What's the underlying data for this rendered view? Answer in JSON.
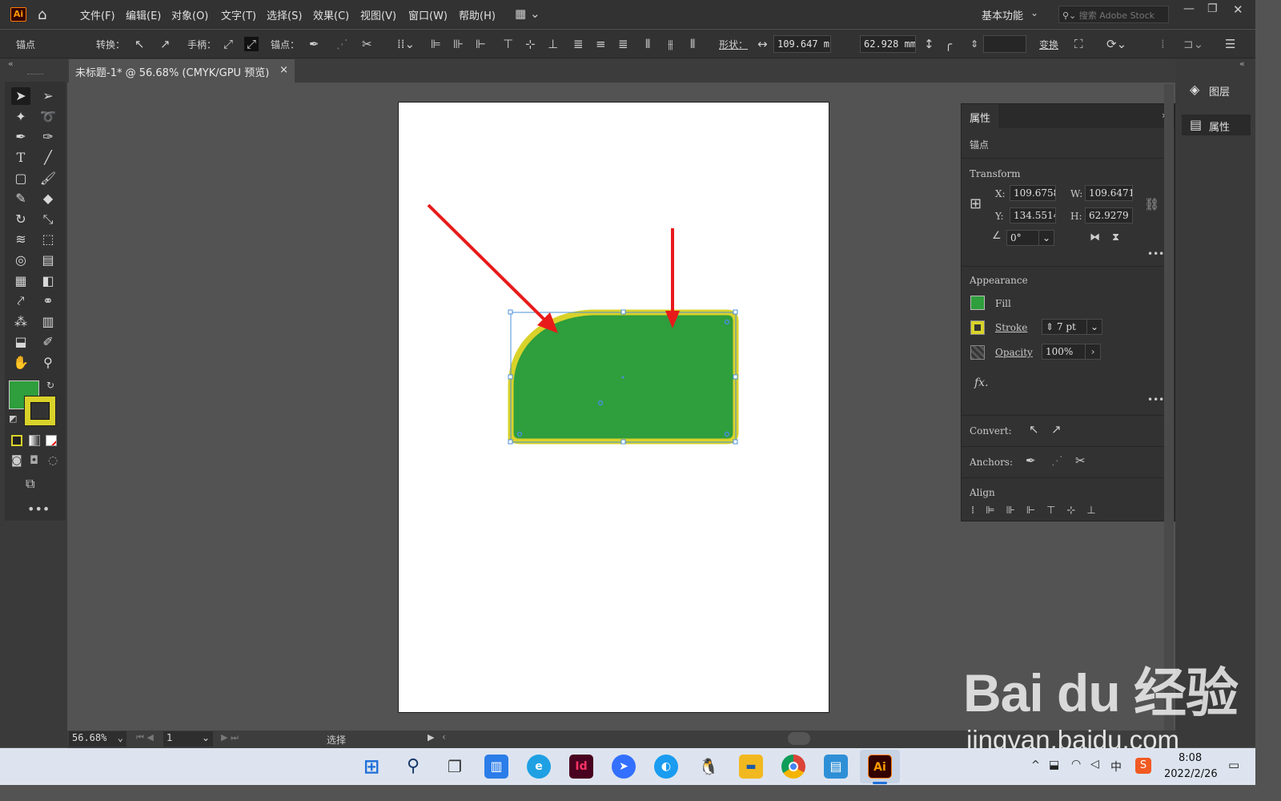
{
  "menubar": {
    "items": [
      "文件(F)",
      "编辑(E)",
      "对象(O)",
      "文字(T)",
      "选择(S)",
      "效果(C)",
      "视图(V)",
      "窗口(W)",
      "帮助(H)"
    ],
    "workspace": "基本功能",
    "search_placeholder": "搜索 Adobe Stock"
  },
  "control": {
    "label": "锚点",
    "convert": "转换：",
    "handles": "手柄：",
    "anchors": "锚点：",
    "shape": "形状：",
    "width_value": "109.647 m",
    "height_value": "62.928 mm",
    "transform_label": "变换"
  },
  "document": {
    "tab_title": "未标题-1* @ 56.68% (CMYK/GPU 预览)",
    "close": "×"
  },
  "panel": {
    "tab": "属性",
    "context": "锚点",
    "transform_title": "Transform",
    "x_label": "X:",
    "x_value": "109.6758",
    "y_label": "Y:",
    "y_value": "134.5514",
    "w_label": "W:",
    "w_value": "109.6471",
    "h_label": "H:",
    "h_value": "62.9279",
    "angle_value": "0°",
    "appearance_title": "Appearance",
    "fill_label": "Fill",
    "stroke_label": "Stroke",
    "stroke_value": "7 pt",
    "opacity_label": "Opacity",
    "opacity_value": "100%",
    "fx": "fx.",
    "convert_label": "Convert:",
    "anchors_label": "Anchors:",
    "align_label": "Align"
  },
  "right_panel": {
    "layers": "图层",
    "properties": "属性"
  },
  "status": {
    "zoom": "56.68%",
    "page": "1",
    "tool": "选择"
  },
  "taskbar": {
    "time": "8:08",
    "date": "2022/2/26",
    "ime": "中"
  },
  "watermark": {
    "brand": "Bai du 经验",
    "url": "jingyan.baidu.com"
  },
  "colors": {
    "fill": "#2f9e3c",
    "stroke": "#d9d22a",
    "arrow": "#e81a1a",
    "selection": "#4a90d9"
  }
}
